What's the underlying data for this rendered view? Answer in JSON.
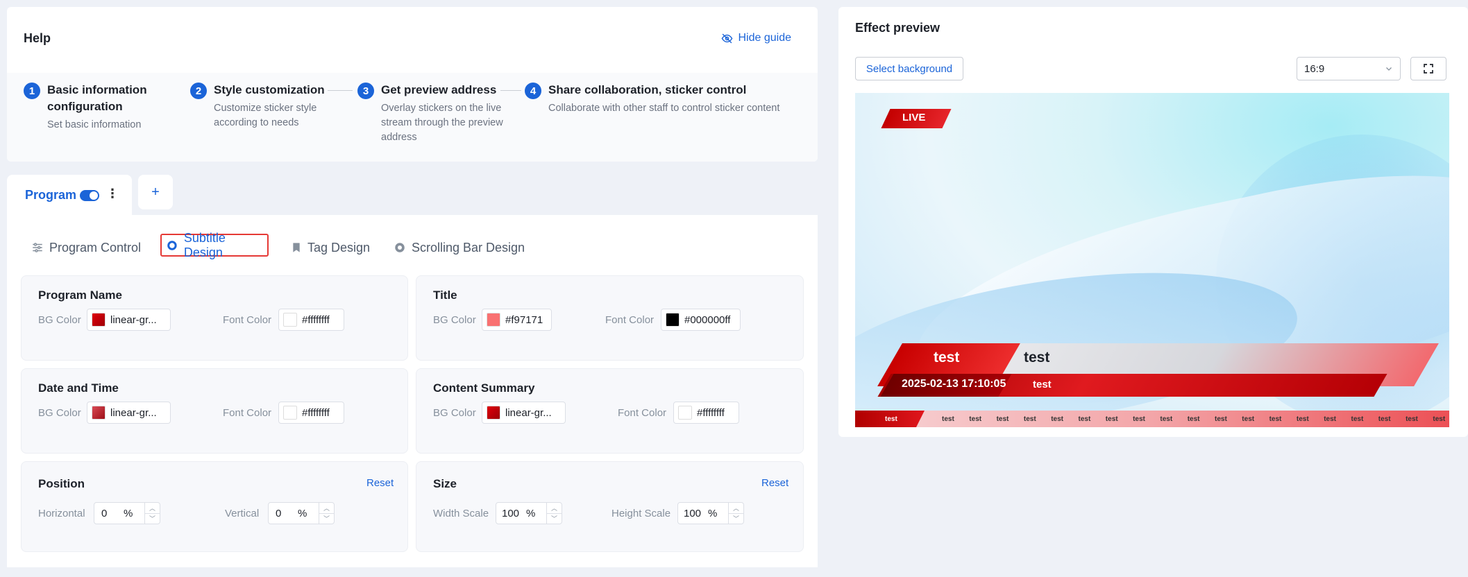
{
  "help": {
    "title": "Help",
    "hide_guide": "Hide guide",
    "steps": [
      {
        "num": "1",
        "title": "Basic information configuration",
        "title_l1": "Basic information",
        "title_l2": "configuration",
        "desc": "Set basic information"
      },
      {
        "num": "2",
        "title": "Style customization",
        "desc_l1": "Customize sticker style",
        "desc_l2": "according to needs"
      },
      {
        "num": "3",
        "title": "Get preview address",
        "desc_l1": "Overlay stickers on the live",
        "desc_l2": "stream through the preview",
        "desc_l3": "address"
      },
      {
        "num": "4",
        "title": "Share collaboration, sticker control",
        "desc": "Collaborate with other staff to control sticker content"
      }
    ]
  },
  "program_tab": {
    "label": "Program",
    "more": "⋮",
    "add": "+",
    "enabled": true
  },
  "subtabs": {
    "program_control": "Program Control",
    "subtitle_design": "Subtitle Design",
    "tag_design": "Tag Design",
    "scrolling_bar_design": "Scrolling Bar Design",
    "active": "subtitle_design"
  },
  "sections": {
    "program_name": {
      "title": "Program Name",
      "bg_label": "BG Color",
      "bg_value": "linear-gr...",
      "bg_swatch": "#d0000a",
      "font_label": "Font Color",
      "font_value": "#ffffffff",
      "font_swatch": "#ffffff"
    },
    "title": {
      "title": "Title",
      "bg_label": "BG Color",
      "bg_value": "#f97171",
      "bg_swatch": "#f97171",
      "font_label": "Font Color",
      "font_value": "#000000ff",
      "font_swatch": "#000000"
    },
    "date_time": {
      "title": "Date and Time",
      "bg_label": "BG Color",
      "bg_value": "linear-gr...",
      "bg_swatch": "#c22b33",
      "font_label": "Font Color",
      "font_value": "#ffffffff",
      "font_swatch": "#ffffff"
    },
    "content_summary": {
      "title": "Content Summary",
      "bg_label": "BG Color",
      "bg_value": "linear-gr...",
      "bg_swatch": "#c8000a",
      "font_label": "Font Color",
      "font_value": "#ffffffff",
      "font_swatch": "#ffffff"
    },
    "position": {
      "title": "Position",
      "reset": "Reset",
      "h_label": "Horizontal",
      "h_value": "0",
      "v_label": "Vertical",
      "v_value": "0",
      "unit": "%"
    },
    "size": {
      "title": "Size",
      "reset": "Reset",
      "w_label": "Width Scale",
      "w_value": "100",
      "h_label": "Height Scale",
      "h_value": "100",
      "unit": "%"
    }
  },
  "preview": {
    "title": "Effect preview",
    "select_background": "Select background",
    "ratio": "16:9",
    "stage": {
      "live": "LIVE",
      "program_name": "test",
      "title": "test",
      "datetime": "2025-02-13 17:10:05",
      "summary": "test",
      "ticker_label": "test",
      "ticker_items": [
        "test",
        "test",
        "test",
        "test",
        "test",
        "test",
        "test",
        "test",
        "test",
        "test",
        "test",
        "test",
        "test",
        "test",
        "test",
        "test",
        "test",
        "test",
        "test"
      ]
    }
  },
  "colors": {
    "accent": "#1b64d8",
    "highlight_border": "#e53935",
    "live_red": "#d0000a"
  }
}
